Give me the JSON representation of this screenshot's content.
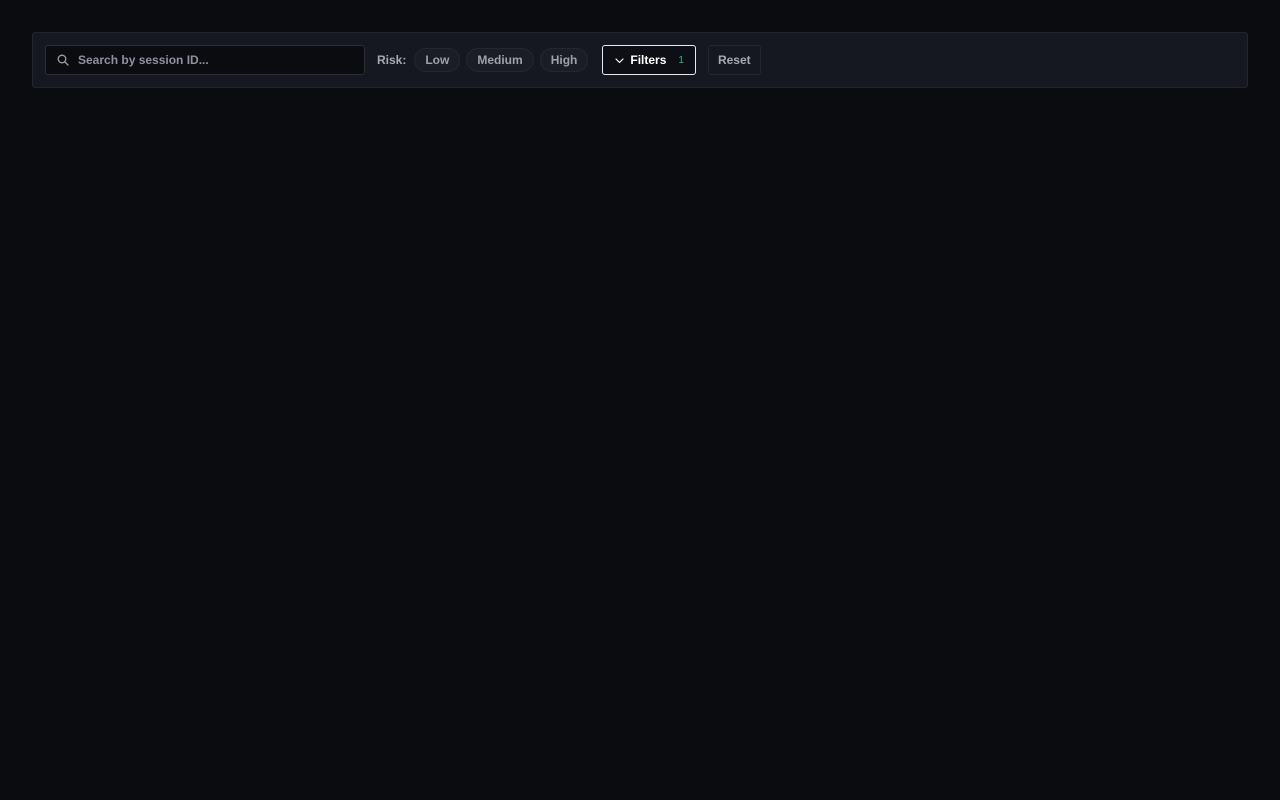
{
  "search": {
    "placeholder": "Search by session ID...",
    "value": "",
    "icon": "search-icon"
  },
  "risk": {
    "label": "Risk:",
    "options": [
      "Low",
      "Medium",
      "High"
    ]
  },
  "filters": {
    "label": "Filters",
    "count": "1",
    "icon": "chevron-down-icon",
    "count_color": "#2ab3a6"
  },
  "reset": {
    "label": "Reset"
  },
  "colors": {
    "background": "#0b0c10",
    "bar": "#16181f",
    "accent": "#2ab3a6"
  }
}
